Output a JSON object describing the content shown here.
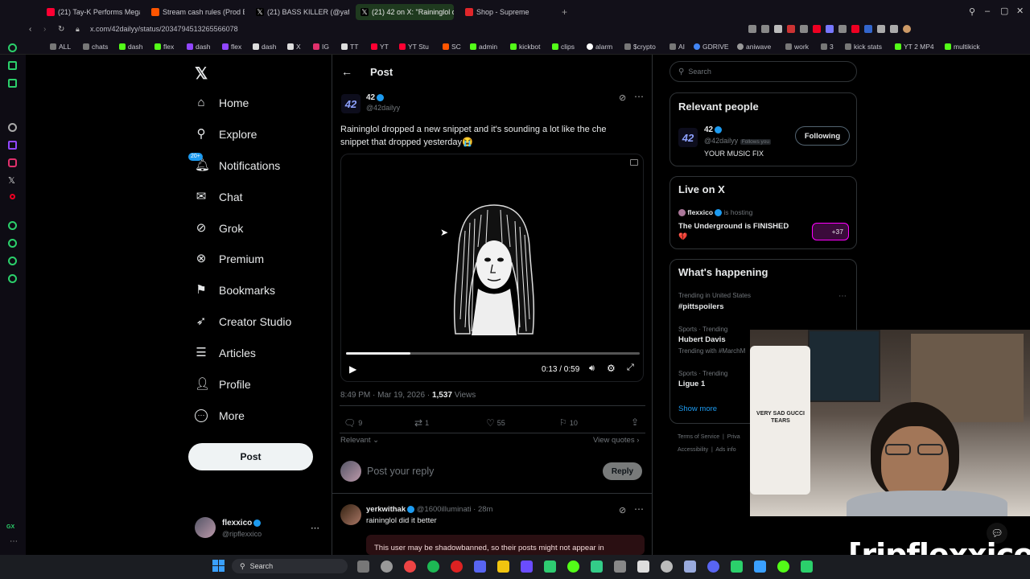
{
  "browser": {
    "tabs": [
      {
        "label": "(21) Tay-K Performs Megan",
        "color": "#ff0033"
      },
      {
        "label": "Stream cash rules (Prod B",
        "color": "#ff5500"
      },
      {
        "label": "(21) BASS KILLER (@yafio",
        "color": "#ffffff"
      },
      {
        "label": "(21) 42 on X: \"Raininglol d",
        "color": "#ffffff"
      },
      {
        "label": "Shop - Supreme",
        "color": "#e0262a"
      }
    ],
    "url": "x.com/42dailyy/status/2034794513265566078",
    "bookmarks": [
      "ALL",
      "chats",
      "dash",
      "flex",
      "dash",
      "flex",
      "dash",
      "X",
      "IG",
      "TT",
      "YT",
      "YT Stu",
      "SC",
      "admin",
      "kickbot",
      "clips",
      "alarm",
      "$crypto",
      "AI",
      "GDRIVE",
      "aniwave",
      "work",
      "3",
      "kick stats",
      "YT 2 MP4",
      "multikick"
    ]
  },
  "sidebar": {
    "items": [
      {
        "label": "Home",
        "icon": "home-icon",
        "glyph": "⌂"
      },
      {
        "label": "Explore",
        "icon": "search-icon",
        "glyph": "⚲"
      },
      {
        "label": "Notifications",
        "icon": "bell-icon",
        "glyph": "🔔︎"
      },
      {
        "label": "Chat",
        "icon": "mail-icon",
        "glyph": "✉"
      },
      {
        "label": "Grok",
        "icon": "grok-icon",
        "glyph": "⊘"
      },
      {
        "label": "Premium",
        "icon": "x-logo-icon",
        "glyph": "⊗"
      },
      {
        "label": "Bookmarks",
        "icon": "bookmark-icon",
        "glyph": "⚑"
      },
      {
        "label": "Creator Studio",
        "icon": "rocket-icon",
        "glyph": "➶"
      },
      {
        "label": "Articles",
        "icon": "article-icon",
        "glyph": "☰"
      },
      {
        "label": "Profile",
        "icon": "person-icon",
        "glyph": "👤︎"
      },
      {
        "label": "More",
        "icon": "more-icon",
        "glyph": "⋯"
      }
    ],
    "notif_badge": "20+",
    "post_label": "Post",
    "account": {
      "name": "flexxico",
      "handle": "@ripflexxico"
    }
  },
  "post": {
    "header": "Post",
    "author_name": "42",
    "author_handle": "@42dailyy",
    "text_line1": "Raininglol dropped a new snippet and it's sounding a lot like the che",
    "text_line2": "snippet that dropped yesterday😭",
    "time": "0:13 / 0:59",
    "progress": 0.22,
    "timestamp": "8:49 PM · Mar 19, 2026 · ",
    "views_count": "1,537",
    "views_label": " Views",
    "replies": "9",
    "reposts": "1",
    "likes": "55",
    "bookmarks": "10",
    "sort": "Relevant",
    "view_quotes": "View quotes",
    "reply_placeholder": "Post your reply",
    "reply_button": "Reply"
  },
  "reply": {
    "name": "yerkwithak",
    "handle": "@1600illuminati · 28m",
    "text": "raininglol did it better",
    "warning": "This user may be shadowbanned, so their posts might not appear in"
  },
  "right": {
    "search_placeholder": "Search",
    "relevant_title": "Relevant people",
    "rp_name": "42",
    "rp_handle": "@42dailyy",
    "rp_follows": "Follows you",
    "rp_bio": "YOUR MUSIC FIX",
    "rp_button": "Following",
    "live_title": "Live on X",
    "live_host": "flexxico",
    "live_hosting": " is hosting",
    "live_text": "The Underground is FINISHED",
    "live_emoji": "💔",
    "live_count": "+37",
    "happening_title": "What's happening",
    "trends": [
      {
        "context": "Trending in United States",
        "name": "#pittspoilers",
        "extra": ""
      },
      {
        "context": "Sports · Trending",
        "name": "Hubert Davis",
        "extra": "Trending with #MarchM"
      },
      {
        "context": "Sports · Trending",
        "name": "Ligue 1",
        "extra": ""
      }
    ],
    "show_more": "Show more",
    "footer1": "Terms of Service  |  Priva",
    "footer2": "Accessibility  |  Ads info"
  },
  "overlay": {
    "watermark": "[ripflexxico]",
    "shirt_text": "VERY SAD GUCCI TEARS"
  },
  "taskbar": {
    "search_label": "Search"
  }
}
